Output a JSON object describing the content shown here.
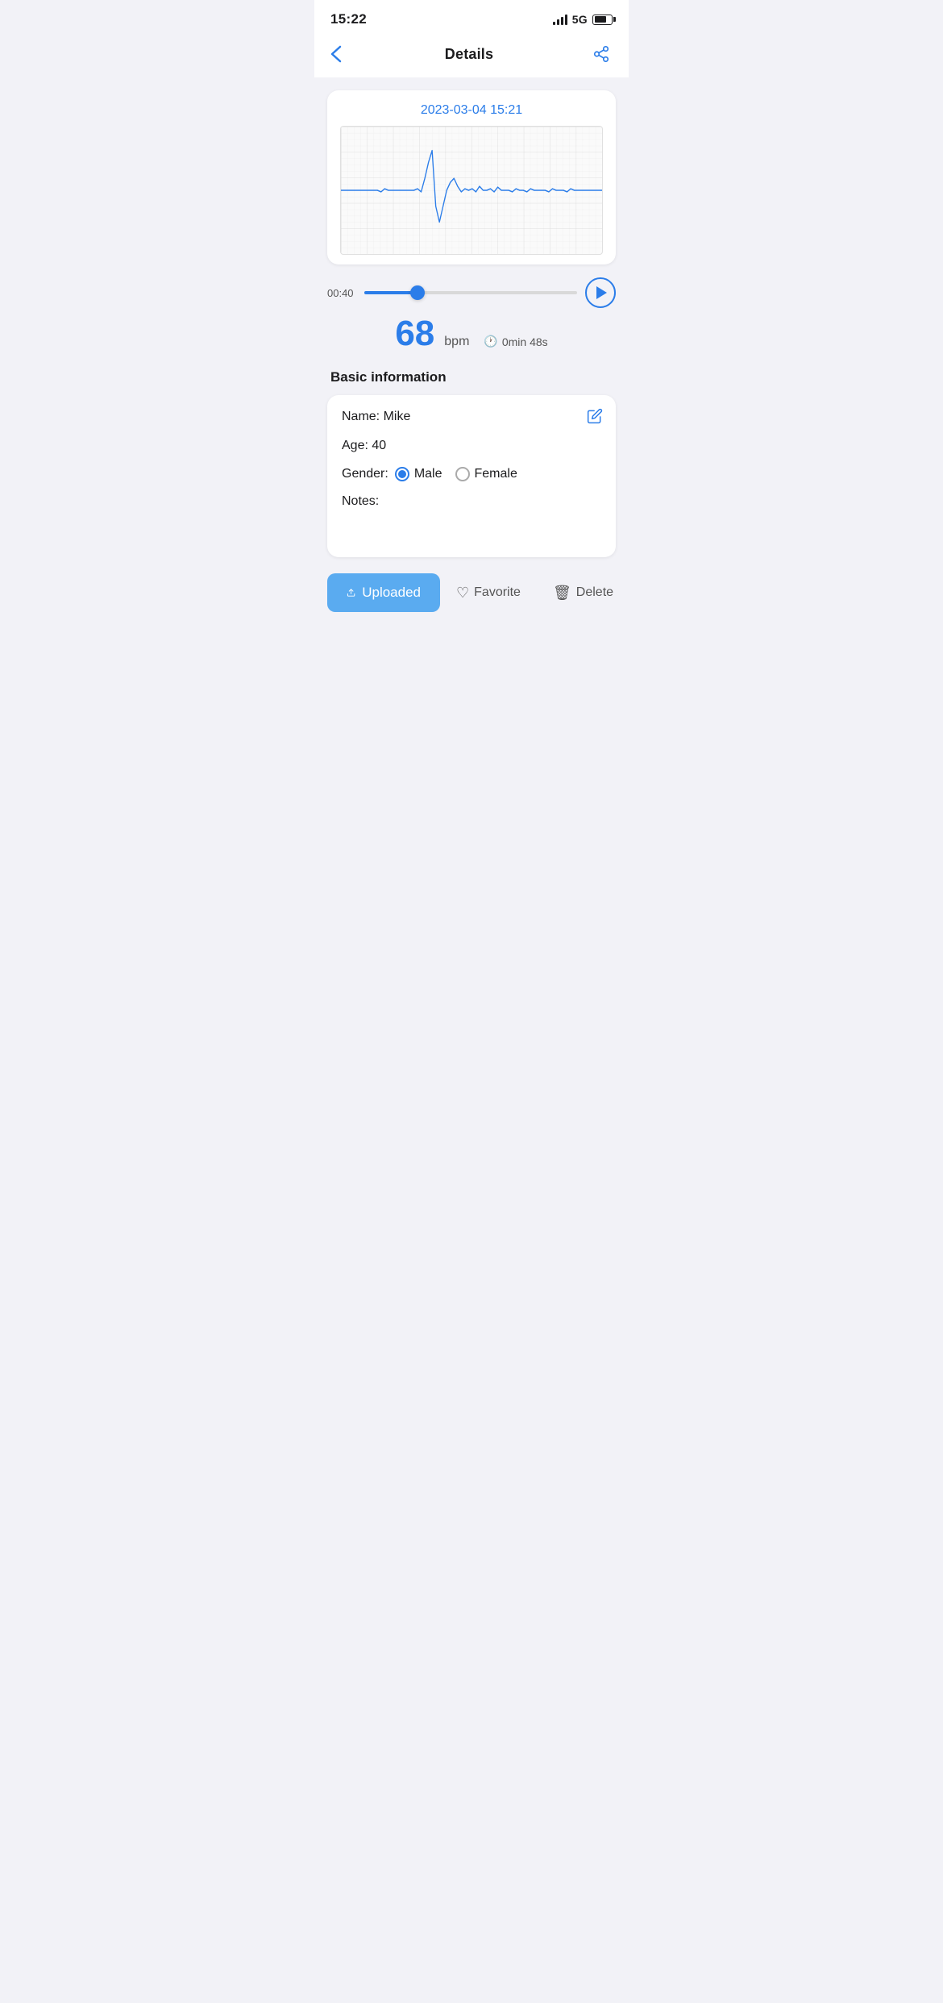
{
  "statusBar": {
    "time": "15:22",
    "network": "5G"
  },
  "header": {
    "title": "Details",
    "backLabel": "‹",
    "shareLabel": "share"
  },
  "ecg": {
    "date": "2023-03-04 15:21"
  },
  "playback": {
    "currentTime": "00:40",
    "progressPercent": 25
  },
  "vitals": {
    "bpm": "68",
    "bpmUnit": "bpm",
    "duration": "0min 48s"
  },
  "basicInfo": {
    "sectionTitle": "Basic information",
    "nameLabel": "Name: Mike",
    "ageLabel": "Age: 40",
    "genderLabel": "Gender:",
    "genderOptions": [
      "Male",
      "Female"
    ],
    "selectedGender": "Male",
    "notesLabel": "Notes:"
  },
  "actions": {
    "uploadLabel": "Uploaded",
    "favoriteLabel": "Favorite",
    "deleteLabel": "Delete"
  }
}
